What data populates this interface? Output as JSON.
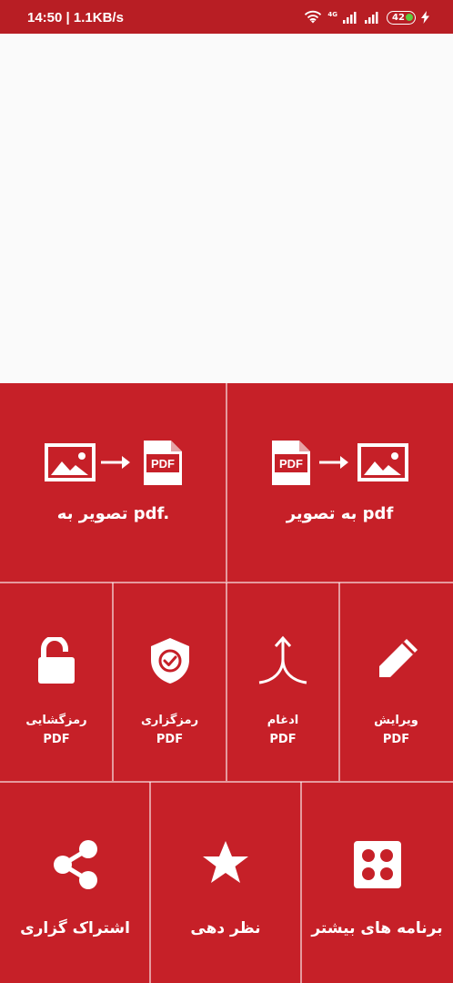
{
  "status_bar": {
    "time": "14:50 | 1.1KB/s",
    "network": "4G",
    "battery": "42"
  },
  "colors": {
    "primary": "#c62028",
    "status_bar": "#b81e24",
    "divider": "#f0b9bc"
  },
  "tiles": {
    "image_to_pdf": {
      "label": "تصویر به pdf.",
      "icon": "image-to-pdf-icon"
    },
    "pdf_to_image": {
      "label": "به تصویر pdf",
      "icon": "pdf-to-image-icon"
    },
    "unlock_pdf": {
      "line1": "رمزگشایی",
      "line2": "PDF",
      "icon": "unlock-icon"
    },
    "protect_pdf": {
      "line1": "رمزگزاری",
      "line2": "PDF",
      "icon": "shield-check-icon"
    },
    "merge_pdf": {
      "line1": "ادغام",
      "line2": "PDF",
      "icon": "merge-arrows-icon"
    },
    "edit_pdf": {
      "line1": "ویرایش",
      "line2": "PDF",
      "icon": "pencil-icon"
    },
    "share": {
      "label": "اشتراک گزاری",
      "icon": "share-icon"
    },
    "rate": {
      "label": "نظر دهی",
      "icon": "star-icon"
    },
    "more_apps": {
      "label": "برنامه های بیشتر",
      "icon": "apps-grid-icon"
    }
  }
}
